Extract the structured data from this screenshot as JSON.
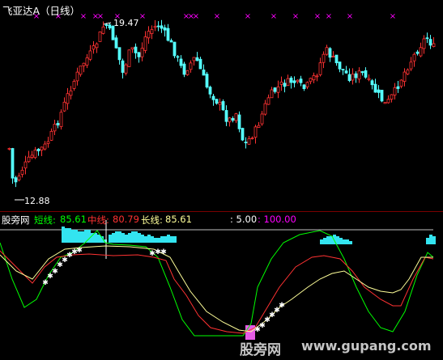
{
  "main_panel": {
    "title": "飞亚达A（日线）",
    "high_label": "19.47",
    "low_label": "12.88",
    "colors": {
      "up": "#ff3232",
      "down": "#54ffff",
      "marker": "#ff00ff"
    }
  },
  "indicator_panel": {
    "site_label": "股旁网",
    "short": {
      "label": "短线:",
      "value": "85.61",
      "color": "#00ff00"
    },
    "mid": {
      "label": "中线:",
      "value": "80.79",
      "color": "#ff3232"
    },
    "long": {
      "label": "长线:",
      "value": "85.61",
      "color": "#ffff99"
    },
    "param1": ": 5.00",
    "param2": ": 100.00",
    "param2_color": "#ff00ff"
  },
  "watermark": {
    "text_cn": "股旁网",
    "text_url": "www.gupang.com"
  }
}
